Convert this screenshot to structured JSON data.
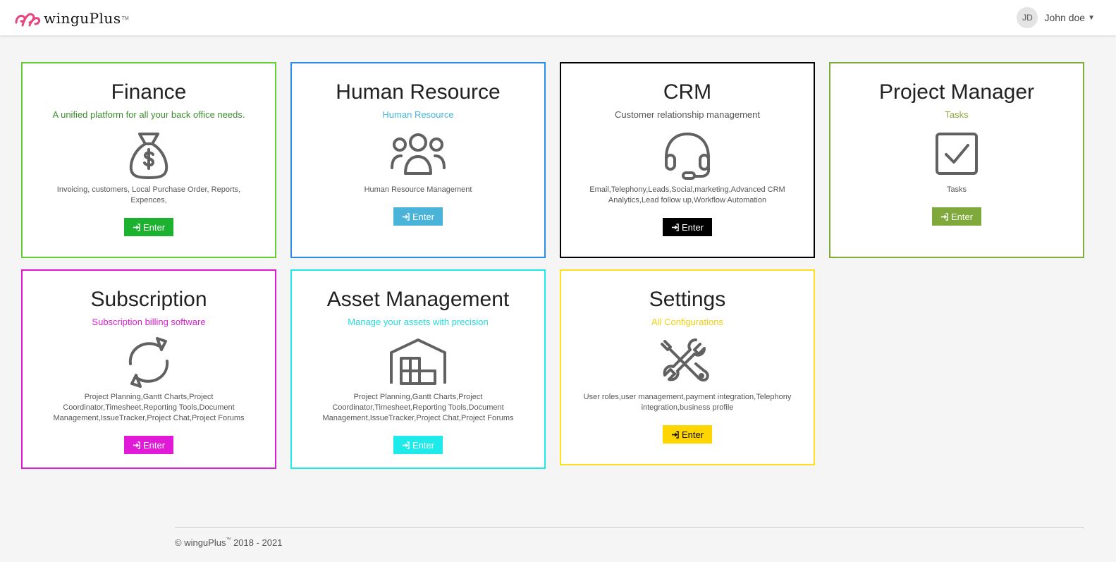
{
  "header": {
    "brand_name": "winguPlus",
    "brand_tm": "TM",
    "user_initials": "JD",
    "user_name": "John doe"
  },
  "cards": [
    {
      "id": "finance",
      "title": "Finance",
      "subtitle": "A unified platform for all your back office needs.",
      "description": "Invoicing, customers, Local Purchase Order, Reports, Expences,",
      "button": "Enter",
      "icon": "money-bag-icon",
      "color": "#66cc33",
      "subtitle_color": "#3c8f2e",
      "button_color": "#1cb12e",
      "button_text_color": "#ffffff"
    },
    {
      "id": "human-resource",
      "title": "Human Resource",
      "subtitle": "Human Resource",
      "description": "Human Resource Management",
      "button": "Enter",
      "icon": "users-group-icon",
      "color": "#2b8ce8",
      "subtitle_color": "#46b6dc",
      "button_color": "#4ab3da",
      "button_text_color": "#ffffff"
    },
    {
      "id": "crm",
      "title": "CRM",
      "subtitle": "Customer relationship management",
      "description": "Email,Telephony,Leads,Social,marketing,Advanced CRM Analytics,Lead follow up,Workflow Automation",
      "button": "Enter",
      "icon": "headset-icon",
      "color": "#000000",
      "subtitle_color": "#555555",
      "button_color": "#000000",
      "button_text_color": "#ffffff"
    },
    {
      "id": "project-manager",
      "title": "Project Manager",
      "subtitle": "Tasks",
      "description": "Tasks",
      "button": "Enter",
      "icon": "checkbox-icon",
      "color": "#7fab3a",
      "subtitle_color": "#8daa3d",
      "button_color": "#80a93c",
      "button_text_color": "#ffffff"
    },
    {
      "id": "subscription",
      "title": "Subscription",
      "subtitle": "Subscription billing software",
      "description": "Project Planning,Gantt Charts,Project Coordinator,Timesheet,Reporting Tools,Document Management,IssueTracker,Project Chat,Project Forums",
      "button": "Enter",
      "icon": "refresh-icon",
      "color": "#e01ad7",
      "subtitle_color": "#d91ed2",
      "button_color": "#e01ad7",
      "button_text_color": "#ffffff"
    },
    {
      "id": "asset-management",
      "title": "Asset Management",
      "subtitle": "Manage your assets with precision",
      "description": "Project Planning,Gantt Charts,Project Coordinator,Timesheet,Reporting Tools,Document Management,IssueTracker,Project Chat,Project Forums",
      "button": "Enter",
      "icon": "warehouse-icon",
      "color": "#1eeaea",
      "subtitle_color": "#26dada",
      "button_color": "#1eeaea",
      "button_text_color": "#ffffff"
    },
    {
      "id": "settings",
      "title": "Settings",
      "subtitle": "All Configurations",
      "description": "User roles,user management,payment integration,Telephony integration,business profile",
      "button": "Enter",
      "icon": "tools-icon",
      "color": "#ffe01a",
      "subtitle_color": "#f0cf10",
      "button_color": "#ffd500",
      "button_text_color": "#111111"
    }
  ],
  "footer": {
    "copyright_prefix": "© winguPlus",
    "tm": "™",
    "years": " 2018 - 2021"
  }
}
